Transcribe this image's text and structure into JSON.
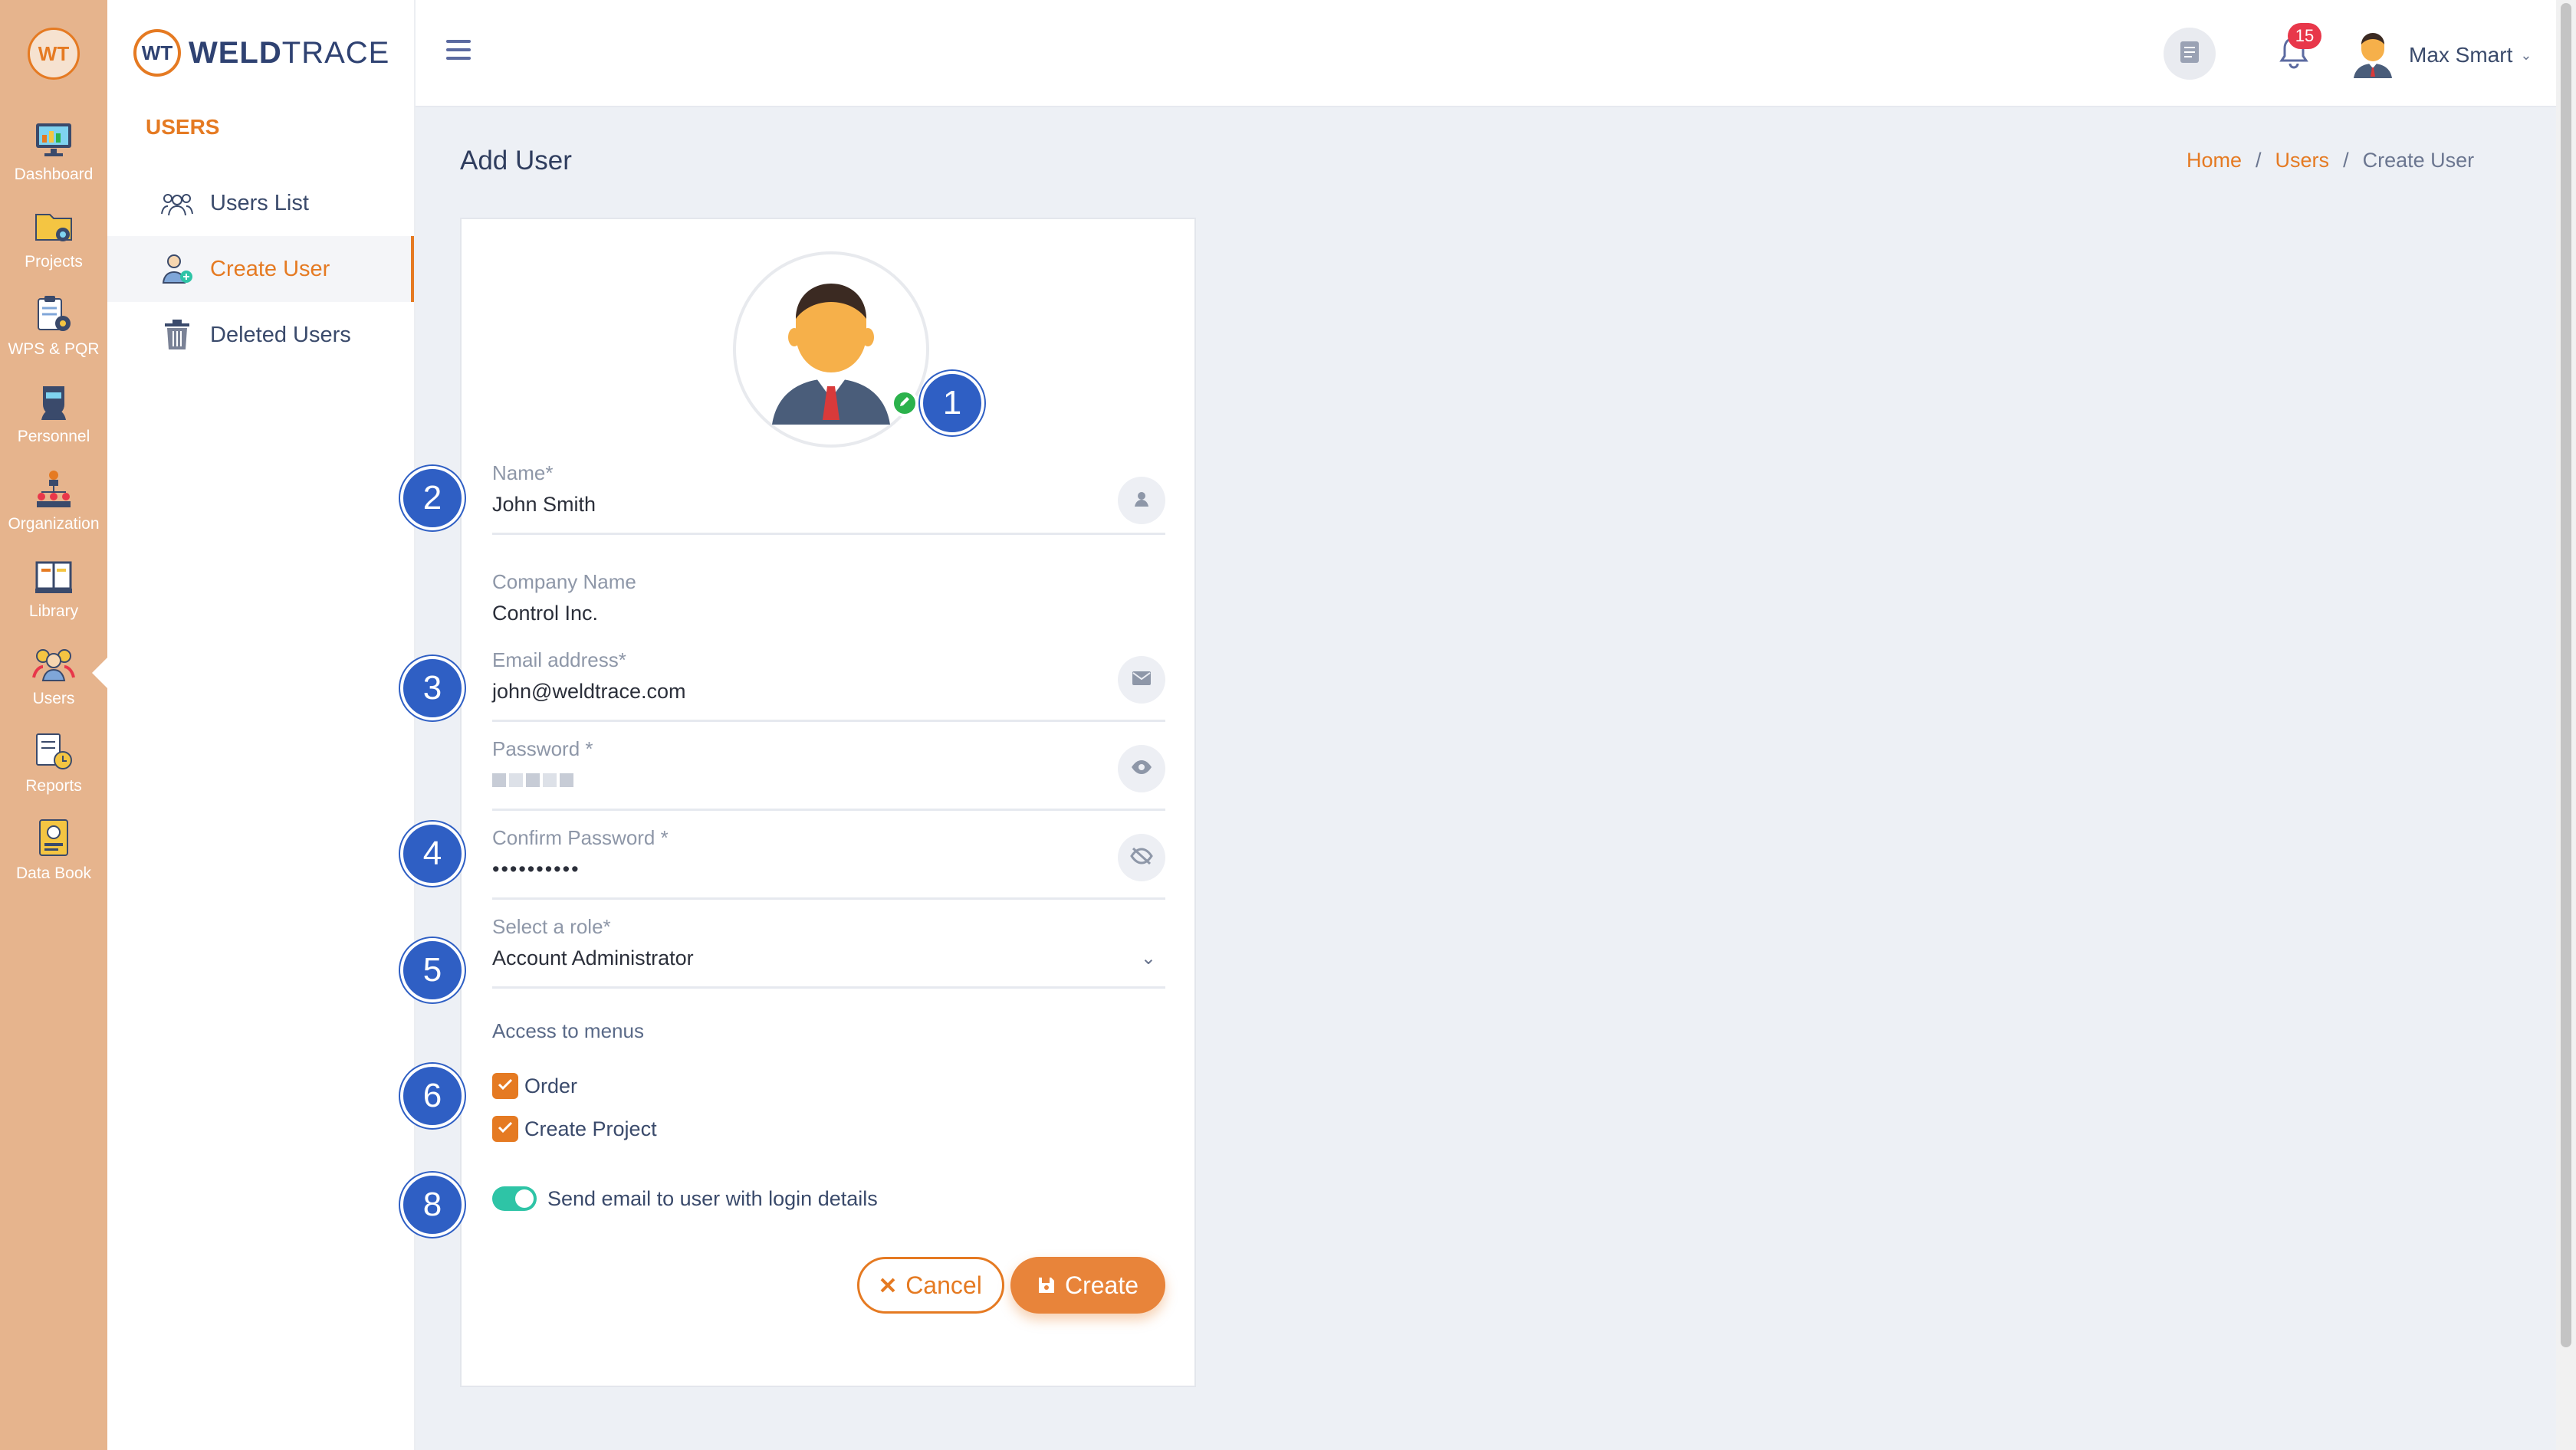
{
  "rail": {
    "logo": "WT",
    "items": [
      {
        "label": "Dashboard",
        "icon": "monitor-icon"
      },
      {
        "label": "Projects",
        "icon": "folder-gear-icon"
      },
      {
        "label": "WPS & PQR",
        "icon": "clipboard-gear-icon"
      },
      {
        "label": "Personnel",
        "icon": "welder-icon"
      },
      {
        "label": "Organization",
        "icon": "org-chart-icon"
      },
      {
        "label": "Library",
        "icon": "book-icon"
      },
      {
        "label": "Users",
        "icon": "users-icon"
      },
      {
        "label": "Reports",
        "icon": "report-clock-icon"
      },
      {
        "label": "Data Book",
        "icon": "databook-icon"
      }
    ],
    "active": "Users",
    "bg_color": "#e6b48d"
  },
  "brand": {
    "mark": "WT",
    "name_bold": "WELD",
    "name_light": "TRACE"
  },
  "subnav": {
    "title": "USERS",
    "items": [
      {
        "label": "Users List",
        "icon": "users-group-icon"
      },
      {
        "label": "Create User",
        "icon": "user-add-icon"
      },
      {
        "label": "Deleted Users",
        "icon": "trash-icon"
      }
    ],
    "active": "Create User"
  },
  "header": {
    "notification_count": "15",
    "user_name": "Max Smart"
  },
  "page": {
    "title": "Add User",
    "breadcrumb": [
      "Home",
      "Users",
      "Create User"
    ]
  },
  "form": {
    "name": {
      "label": "Name*",
      "value": "John Smith"
    },
    "company": {
      "label": "Company Name",
      "value": "Control Inc."
    },
    "email": {
      "label": "Email address*",
      "value": "john@weldtrace.com"
    },
    "password": {
      "label": "Password *"
    },
    "confirm_password": {
      "label": "Confirm Password *",
      "value": "••••••••••"
    },
    "role": {
      "label": "Select a role*",
      "value": "Account Administrator"
    },
    "access_label": "Access to menus",
    "access_items": [
      {
        "label": "Order",
        "checked": true
      },
      {
        "label": "Create Project",
        "checked": true
      }
    ],
    "send_email": {
      "label": "Send email to user with login details",
      "on": true
    },
    "cancel_label": "Cancel",
    "create_label": "Create"
  },
  "markers": [
    "1",
    "2",
    "3",
    "4",
    "5",
    "6",
    "8"
  ],
  "colors": {
    "accent": "#e57a22",
    "marker": "#2f5fc4",
    "toggle": "#2ec4a6",
    "badge": "#e8374a"
  }
}
